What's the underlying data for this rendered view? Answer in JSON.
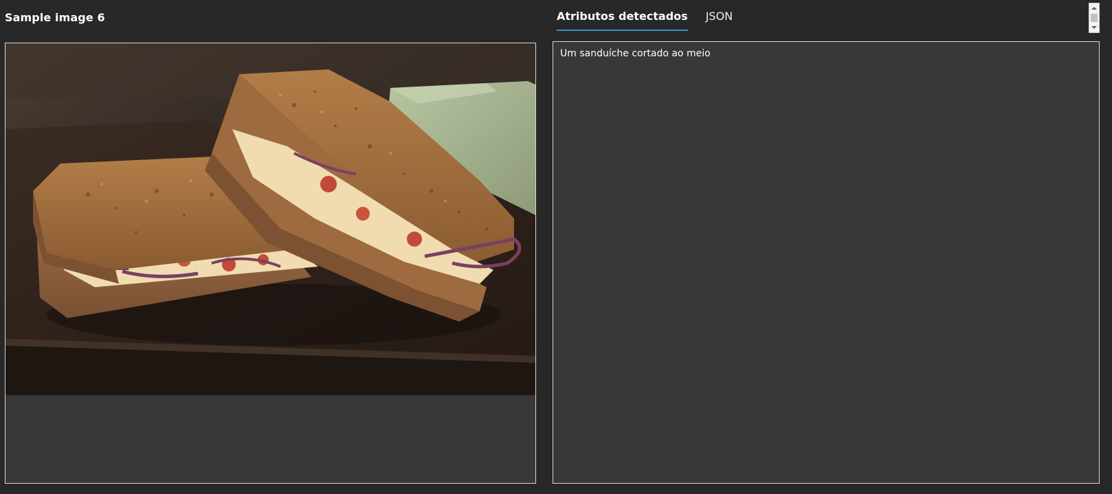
{
  "sample": {
    "title": "Sample image 6"
  },
  "tabs": [
    {
      "label": "Atributos detectados",
      "active": true
    },
    {
      "label": "JSON",
      "active": false
    }
  ],
  "result": {
    "caption": "Um sanduíche cortado ao meio"
  },
  "colors": {
    "background": "#282828",
    "panel": "#383838",
    "border": "#d9d9d9",
    "accent": "#2f8fd8",
    "text": "#ffffff"
  }
}
